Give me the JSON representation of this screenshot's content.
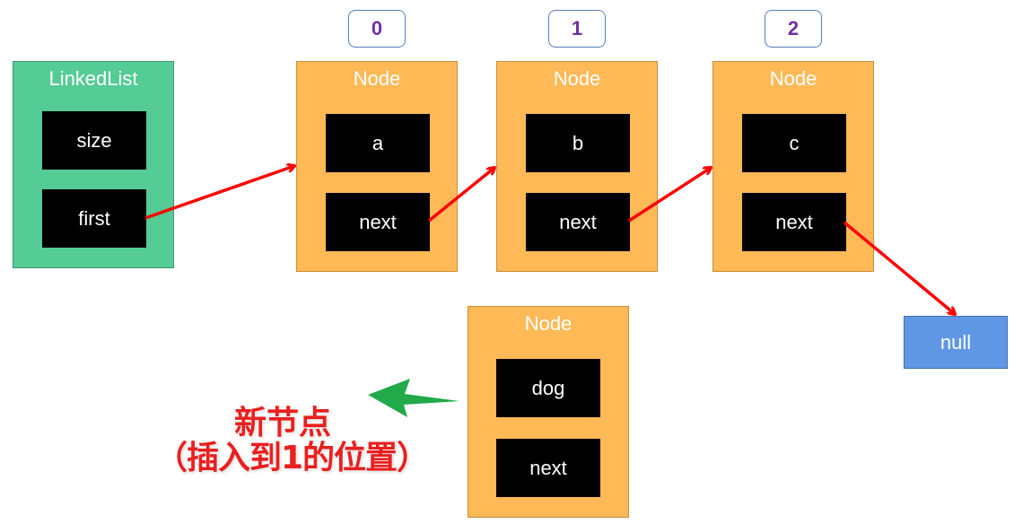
{
  "diagram": {
    "linked_list": {
      "title": "LinkedList",
      "fields": [
        "size",
        "first"
      ],
      "color": "#55CB95"
    },
    "nodes": [
      {
        "index": "0",
        "title": "Node",
        "value": "a",
        "next": "next"
      },
      {
        "index": "1",
        "title": "Node",
        "value": "b",
        "next": "next"
      },
      {
        "index": "2",
        "title": "Node",
        "value": "c",
        "next": "next"
      }
    ],
    "new_node": {
      "title": "Node",
      "value": "dog",
      "next": "next"
    },
    "null_box": {
      "label": "null",
      "color": "#6097E5"
    },
    "annotation": {
      "line1": "新节点",
      "line2": "（插入到1的位置）",
      "color": "#E8201F"
    },
    "colors": {
      "node": "#FFB957",
      "pointer_arrow": "#FF0000",
      "new_node_arrow": "#22AA4A",
      "index_text": "#7030A0"
    }
  }
}
